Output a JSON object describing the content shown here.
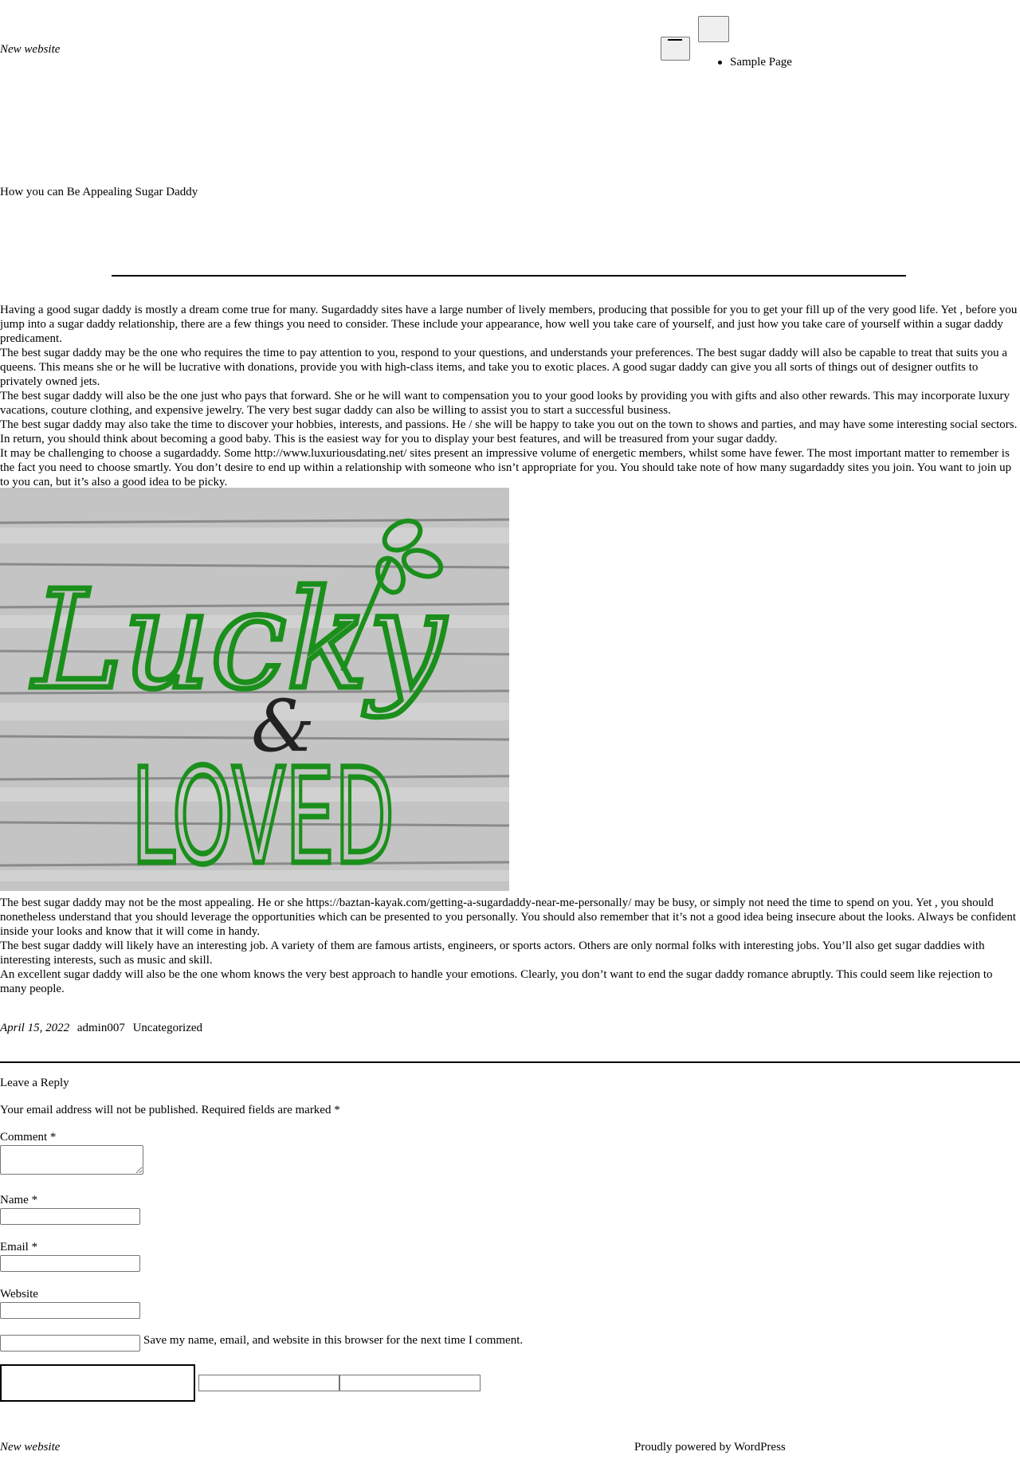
{
  "header": {
    "site_title": "New website",
    "nav_items": [
      "Sample Page"
    ]
  },
  "post": {
    "title": "How you can Be Appealing Sugar Daddy",
    "paragraphs_before_image": [
      "Having a good sugar daddy is mostly a dream come true for many. Sugardaddy sites have a large number of lively members, producing that possible for you to get your fill up of the very good life. Yet , before you jump into a sugar daddy relationship, there are a few things you need to consider. These include your appearance, how well you take care of yourself, and just how you take care of yourself within a sugar daddy predicament.",
      "The best sugar daddy may be the one who requires the time to pay attention to you, respond to your questions, and understands your preferences. The best sugar daddy will also be capable to treat that suits you a queens. This means she or he will be lucrative with donations, provide you with high-class items, and take you to exotic places. A good sugar daddy can give you all sorts of things out of designer outfits to privately owned jets.",
      "The best sugar daddy will also be the one just who pays that forward. She or he will want to compensation you to your good looks by providing you with gifts and also other rewards. This may incorporate luxury vacations, couture clothing, and expensive jewelry. The very best sugar daddy can also be willing to assist you to start a successful business.",
      "The best sugar daddy may also take the time to discover your hobbies, interests, and passions. He / she will be happy to take you out on the town to shows and parties, and may have some interesting social sectors. In return, you should think about becoming a good baby. This is the easiest way for you to display your best features, and will be treasured from your sugar daddy.",
      "It may be challenging to choose a sugardaddy. Some http://www.luxuriousdating.net/ sites present an impressive volume of energetic members, whilst some have fewer. The most important matter to remember is the fact you need to choose smartly. You don’t desire to end up within a relationship with someone who isn’t appropriate for you. You should take note of how many sugardaddy sites you join. You want to join up to you can, but it’s also a good idea to be picky."
    ],
    "image": {
      "word1": "Lucky",
      "amp": "&",
      "word2": "LOVED"
    },
    "paragraphs_after_image": [
      "The best sugar daddy may not be the most appealing. He or she https://baztan-kayak.com/getting-a-sugardaddy-near-me-personally/ may be busy, or simply not need the time to spend on you. Yet , you should nonetheless understand that you should leverage the opportunities which can be presented to you personally. You should also remember that it’s not a good idea being insecure about the looks. Always be confident inside your looks and know that it will come in handy.",
      "The best sugar daddy will likely have an interesting job. A variety of them are famous artists, engineers, or sports actors. Others are only normal folks with interesting jobs. You’ll also get sugar daddies with interesting interests, such as music and skill.",
      "An excellent sugar daddy will also be the one whom knows the very best approach to handle your emotions. Clearly, you don’t want to end the sugar daddy romance abruptly. This could seem like rejection to many people."
    ],
    "meta": {
      "date": "April 15, 2022",
      "author": "admin007",
      "category": "Uncategorized"
    }
  },
  "comments": {
    "reply_title": "Leave a Reply",
    "notice": "Your email address will not be published. Required fields are marked *",
    "comment_label": "Comment *",
    "name_label": "Name *",
    "email_label": "Email *",
    "website_label": "Website",
    "cookie_label": "Save my name, email, and website in this browser for the next time I comment."
  },
  "footer": {
    "site_title": "New website",
    "powered_by": "Proudly powered by WordPress"
  },
  "colors": {
    "text": "#000000",
    "background": "#ffffff",
    "image_green": "#1b8f1b"
  }
}
